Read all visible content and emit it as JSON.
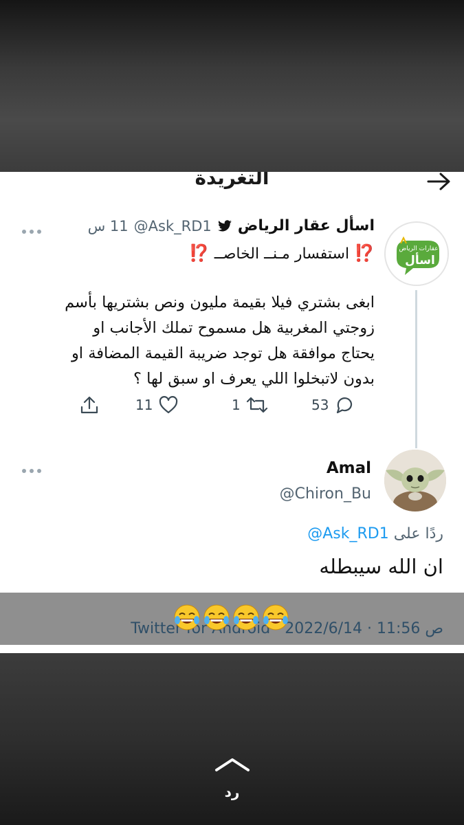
{
  "page": {
    "title": "التغريدة"
  },
  "original_tweet": {
    "display_name": "اسأل عقار الرياض",
    "handle": "@Ask_RD1",
    "time": "11 س",
    "subtitle": "استفسار مـنــ الخاصــ",
    "subtitle_mark": "⁉️",
    "body_lines": [
      "ابغى بشتري فيلا بقيمة مليون ونص بشتريها بأسم",
      "زوجتي المغربية هل مسموح تملك الأجانب او",
      "يحتاج موافقة هل توجد ضريبة القيمة المضافة او",
      "بدون لاتبخلوا اللي يعرف او سبق لها ؟"
    ],
    "avatar_text_top": "عقارات الرياض",
    "avatar_text_main": "اسأل",
    "counts": {
      "replies": "53",
      "retweets": "1",
      "likes": "11"
    }
  },
  "reply_tweet": {
    "display_name": "Amal",
    "handle": "@Chiron_Bu",
    "replying_to_prefix": "ردًا على",
    "replying_to_handle": "@Ask_RD1",
    "text": "ان الله سيبطله"
  },
  "footer": {
    "meta": "Twitter for Android · ص 11:56 · 2022/6/14",
    "emoji_count": 4
  },
  "story_ui": {
    "reply_label": "رد"
  },
  "colors": {
    "accent_link": "#1d9bf0",
    "question_mark": "#d8232a",
    "secondary_text": "#536471"
  }
}
